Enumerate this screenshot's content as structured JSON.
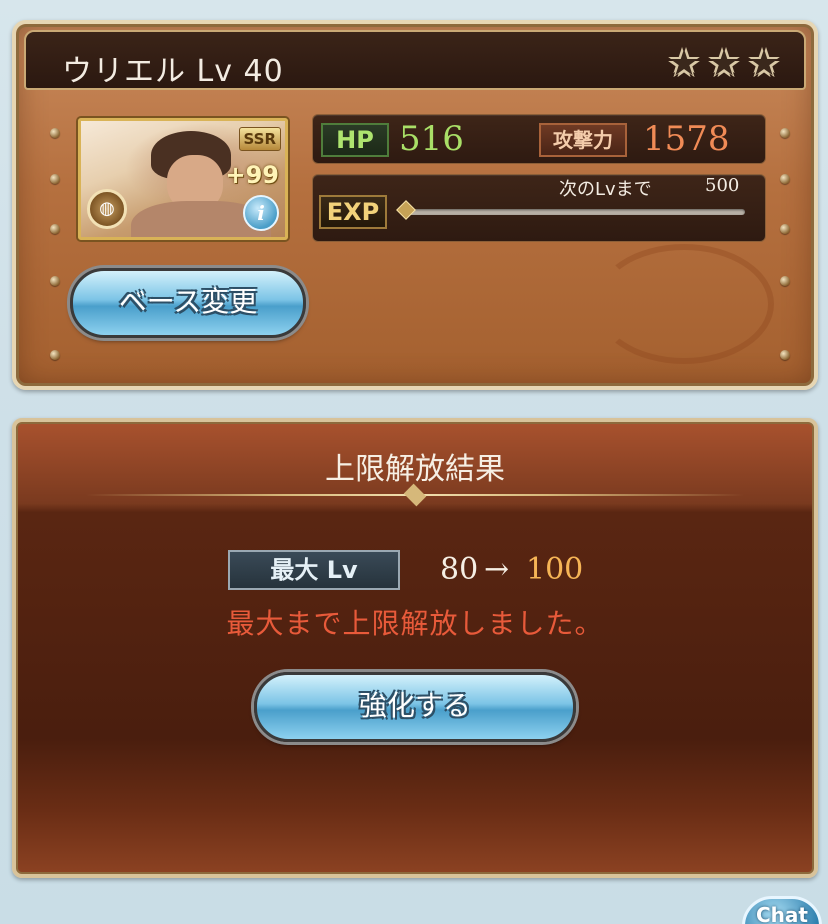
{
  "character": {
    "title": "ウリエル Lv 40",
    "rarity": "SSR",
    "plus": "+99",
    "stars": 3,
    "star_glyph": "★",
    "element_icon": "earth-element-icon",
    "element_glyph": "◍",
    "info_glyph": "i"
  },
  "stats": {
    "hp_label": "HP",
    "hp_value": "516",
    "atk_label": "攻撃力",
    "atk_value": "1578",
    "exp_label": "EXP",
    "next_label": "次のLvまで",
    "next_value": "500",
    "exp_progress": 0
  },
  "buttons": {
    "base_change": "ベース変更",
    "enhance": "強化する",
    "chat": "Chat"
  },
  "result": {
    "title": "上限解放結果",
    "maxlv_label": "最大 Lv",
    "lv_from": "80",
    "lv_arrow": "→",
    "lv_to": "100",
    "message": "最大まで上限解放しました。"
  },
  "colors": {
    "hp": "#a9df67",
    "atk": "#f08b56",
    "lv_to": "#f6b556",
    "message": "#e85a3a"
  }
}
